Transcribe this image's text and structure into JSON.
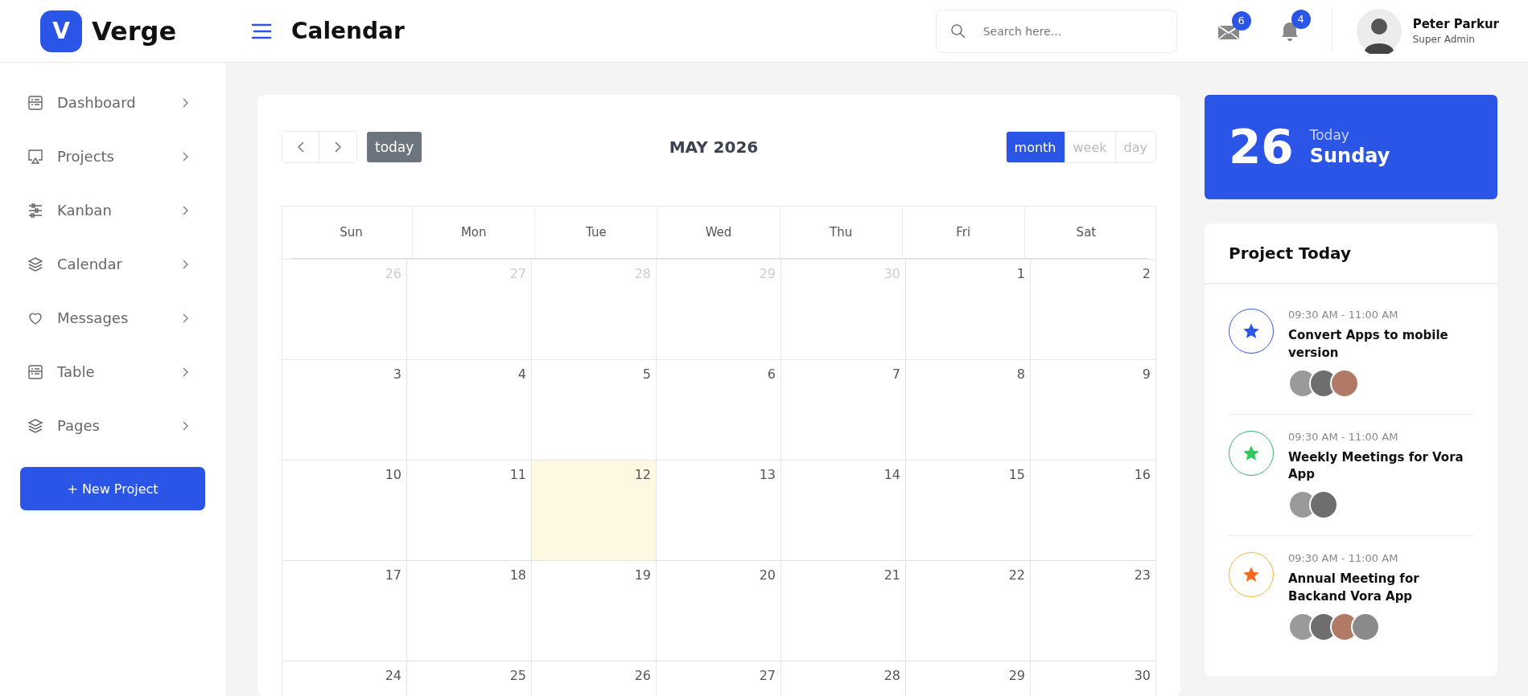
{
  "brand": {
    "logo_letter": "V",
    "name": "Verge"
  },
  "header": {
    "title": "Calendar",
    "search": {
      "placeholder": "Search here..."
    },
    "mail_badge": "6",
    "bell_badge": "4",
    "user": {
      "name": "Peter Parkur",
      "role": "Super Admin"
    }
  },
  "sidebar": {
    "items": [
      {
        "label": "Dashboard"
      },
      {
        "label": "Projects"
      },
      {
        "label": "Kanban"
      },
      {
        "label": "Calendar"
      },
      {
        "label": "Messages"
      },
      {
        "label": "Table"
      },
      {
        "label": "Pages"
      }
    ],
    "new_button": "+ New Project"
  },
  "calendar": {
    "today_button": "today",
    "title": "MAY 2026",
    "views": [
      {
        "label": "month",
        "selected": true
      },
      {
        "label": "week",
        "selected": false
      },
      {
        "label": "day",
        "selected": false
      }
    ],
    "weekdays": [
      "Sun",
      "Mon",
      "Tue",
      "Wed",
      "Thu",
      "Fri",
      "Sat"
    ],
    "weeks": [
      [
        {
          "day": "26",
          "outside": true,
          "highlighted": false
        },
        {
          "day": "27",
          "outside": true,
          "highlighted": false
        },
        {
          "day": "28",
          "outside": true,
          "highlighted": false
        },
        {
          "day": "29",
          "outside": true,
          "highlighted": false
        },
        {
          "day": "30",
          "outside": true,
          "highlighted": false
        },
        {
          "day": "1",
          "outside": false,
          "highlighted": false
        },
        {
          "day": "2",
          "outside": false,
          "highlighted": false
        }
      ],
      [
        {
          "day": "3",
          "outside": false,
          "highlighted": false
        },
        {
          "day": "4",
          "outside": false,
          "highlighted": false
        },
        {
          "day": "5",
          "outside": false,
          "highlighted": false
        },
        {
          "day": "6",
          "outside": false,
          "highlighted": false
        },
        {
          "day": "7",
          "outside": false,
          "highlighted": false
        },
        {
          "day": "8",
          "outside": false,
          "highlighted": false
        },
        {
          "day": "9",
          "outside": false,
          "highlighted": false
        }
      ],
      [
        {
          "day": "10",
          "outside": false,
          "highlighted": false
        },
        {
          "day": "11",
          "outside": false,
          "highlighted": false
        },
        {
          "day": "12",
          "outside": false,
          "highlighted": true
        },
        {
          "day": "13",
          "outside": false,
          "highlighted": false
        },
        {
          "day": "14",
          "outside": false,
          "highlighted": false
        },
        {
          "day": "15",
          "outside": false,
          "highlighted": false
        },
        {
          "day": "16",
          "outside": false,
          "highlighted": false
        }
      ],
      [
        {
          "day": "17",
          "outside": false,
          "highlighted": false
        },
        {
          "day": "18",
          "outside": false,
          "highlighted": false
        },
        {
          "day": "19",
          "outside": false,
          "highlighted": false
        },
        {
          "day": "20",
          "outside": false,
          "highlighted": false
        },
        {
          "day": "21",
          "outside": false,
          "highlighted": false
        },
        {
          "day": "22",
          "outside": false,
          "highlighted": false
        },
        {
          "day": "23",
          "outside": false,
          "highlighted": false
        }
      ],
      [
        {
          "day": "24",
          "outside": false,
          "highlighted": false
        },
        {
          "day": "25",
          "outside": false,
          "highlighted": false
        },
        {
          "day": "26",
          "outside": false,
          "highlighted": false
        },
        {
          "day": "27",
          "outside": false,
          "highlighted": false
        },
        {
          "day": "28",
          "outside": false,
          "highlighted": false
        },
        {
          "day": "29",
          "outside": false,
          "highlighted": false
        },
        {
          "day": "30",
          "outside": false,
          "highlighted": false
        }
      ]
    ]
  },
  "today_card": {
    "date": "26",
    "label": "Today",
    "weekday": "Sunday"
  },
  "project_today": {
    "title": "Project Today",
    "projects": [
      {
        "time": "09:30 AM - 11:00 AM",
        "name": "Convert Apps to mobile version",
        "color": "#2b55e6",
        "avatars": [
          {
            "kind": "photo"
          },
          {
            "kind": "photo"
          },
          {
            "kind": "photo"
          }
        ]
      },
      {
        "time": "09:30 AM - 11:00 AM",
        "name": "Weekly Meetings for Vora App",
        "color": "#32c75a",
        "avatars": [
          {
            "kind": "photo"
          },
          {
            "kind": "photo"
          }
        ]
      },
      {
        "time": "09:30 AM - 11:00 AM",
        "name": "Annual Meeting for Backand Vora App",
        "color": "#f26a21",
        "avatars": [
          {
            "kind": "photo"
          },
          {
            "kind": "photo"
          },
          {
            "kind": "photo"
          },
          {
            "kind": "photo"
          }
        ]
      }
    ]
  }
}
